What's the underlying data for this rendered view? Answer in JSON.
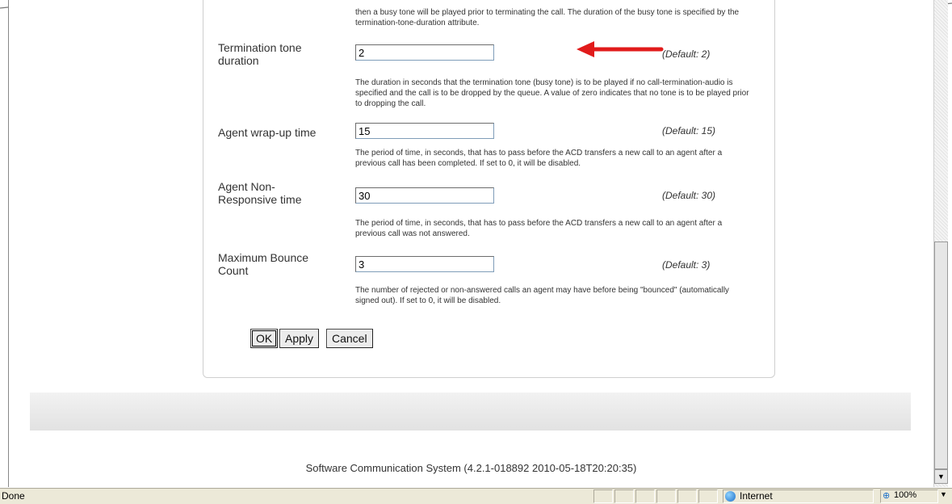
{
  "top_help": "then a busy tone will be played prior to terminating the call. The duration of the busy tone is specified by the termination-tone-duration attribute.",
  "rows": [
    {
      "label": "Termination tone duration",
      "value": "2",
      "default": "(Default: 2)",
      "help": "The duration in seconds that the termination tone (busy tone) is to be played if no call-termination-audio is specified and the call is to be dropped by the queue. A value of zero indicates that no tone is to be played prior to dropping the call."
    },
    {
      "label": "Agent wrap-up time",
      "value": "15",
      "default": "(Default: 15)",
      "help": "The period of time, in seconds, that has to pass before the ACD transfers a new call to an agent after a previous call has been completed. If set to 0, it will be disabled."
    },
    {
      "label": "Agent Non-Responsive time",
      "value": "30",
      "default": "(Default: 30)",
      "help": "The period of time, in seconds, that has to pass before the ACD transfers a new call to an agent after a previous call was not answered."
    },
    {
      "label": "Maximum Bounce Count",
      "value": "3",
      "default": "(Default: 3)",
      "help": "The number of rejected or non-answered calls an agent may have before being \"bounced\" (automatically signed out). If set to 0, it will be disabled."
    }
  ],
  "buttons": {
    "ok": "OK",
    "apply": "Apply",
    "cancel": "Cancel"
  },
  "footer": "Software Communication System (4.2.1-018892 2010-05-18T20:20:35)",
  "statusbar": {
    "status": "Done",
    "zone": "Internet",
    "zoom": "100%"
  },
  "colors": {
    "arrow": "#e11b1b",
    "statusbar_bg": "#ece9d8"
  }
}
